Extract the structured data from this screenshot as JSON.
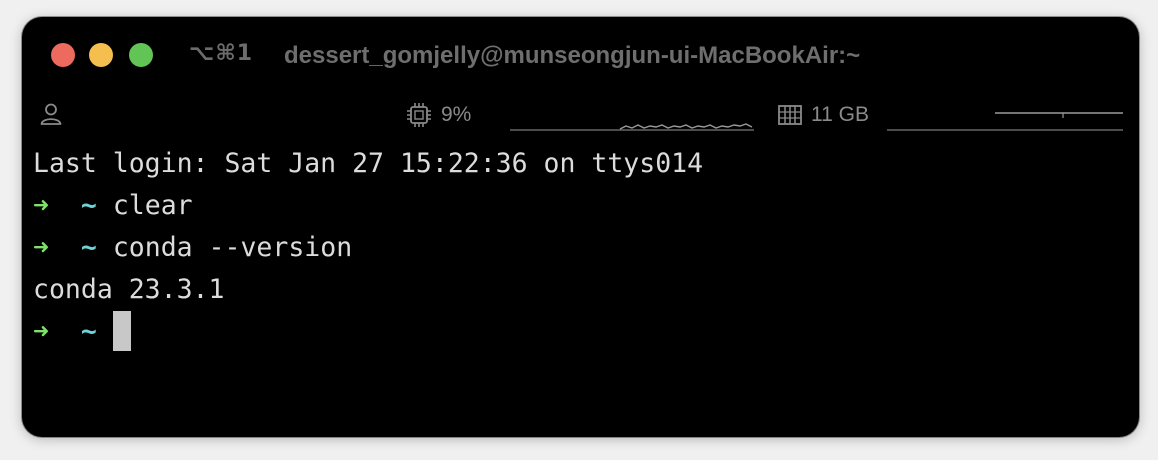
{
  "window": {
    "shortcut": "⌥⌘1",
    "title": "dessert_gomjelly@munseongjun-ui-MacBookAir:~"
  },
  "traffic_lights": {
    "close_color": "#ed6a5e",
    "minimize_color": "#f5bf4f",
    "maximize_color": "#61c454"
  },
  "status": {
    "user_icon": "person-icon",
    "cpu_icon": "cpu-chip-icon",
    "cpu_text": "9%",
    "memory_icon": "memory-icon",
    "memory_text": "11 GB"
  },
  "terminal": {
    "login_line": "Last login: Sat Jan 27 15:22:36 on ttys014",
    "prompt_arrow": "➜",
    "prompt_dir": "~",
    "commands": [
      {
        "text": "clear"
      },
      {
        "text": "conda --version"
      }
    ],
    "output": "conda 23.3.1"
  },
  "colors": {
    "background": "#000000",
    "text": "#dcdcdc",
    "prompt_arrow": "#7fe06a",
    "prompt_dir": "#6fd3d6",
    "cursor": "#c8c8c8"
  }
}
